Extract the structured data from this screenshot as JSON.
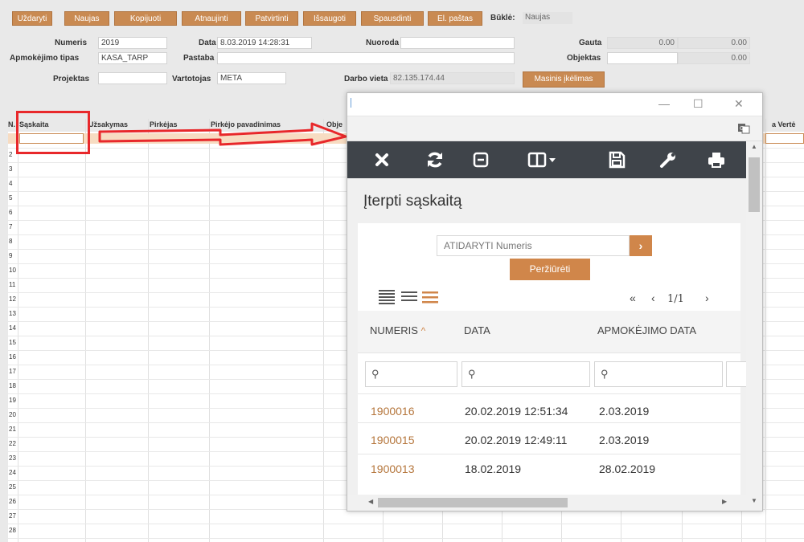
{
  "toolbar": {
    "buttons": [
      "Uždaryti",
      "Naujas",
      "Kopijuoti",
      "Atnaujinti",
      "Patvirtinti",
      "Išsaugoti",
      "Spausdinti",
      "El. paštas"
    ],
    "status_label": "Būklė:",
    "status_value": "Naujas"
  },
  "form": {
    "numeris_label": "Numeris",
    "numeris_value": "2019",
    "data_label": "Data",
    "data_value": "8.03.2019 14:28:31",
    "nuoroda_label": "Nuoroda",
    "nuoroda_value": "",
    "gauta_label": "Gauta",
    "gauta_value1": "0.00",
    "gauta_value2": "0.00",
    "apmokejimo_label": "Apmokėjimo tipas",
    "apmokejimo_value": "KASA_TARP",
    "pastaba_label": "Pastaba",
    "pastaba_value": "",
    "objektas_label": "Objektas",
    "objektas_value": "",
    "objektas_amount": "0.00",
    "projektas_label": "Projektas",
    "projektas_value": "",
    "vartotojas_label": "Vartotojas",
    "vartotojas_value": "META",
    "darbo_label": "Darbo vieta",
    "darbo_value": "82.135.174.44",
    "masinis_button": "Masinis įkėlimas"
  },
  "grid": {
    "headers": {
      "nr": "N.",
      "saskaita": "Sąskaita",
      "uzsakymas": "Užsakymas",
      "pirkejas": "Pirkėjas",
      "pavadinimas": "Pirkėjo pavadinimas",
      "obj": "Obje",
      "verte": "a Vertė"
    },
    "rows": [
      "1",
      "2",
      "3",
      "4",
      "5",
      "6",
      "7",
      "8",
      "9",
      "10",
      "11",
      "12",
      "13",
      "14",
      "15",
      "16",
      "17",
      "18",
      "19",
      "20",
      "21",
      "22",
      "23",
      "24",
      "25",
      "26",
      "27",
      "28"
    ]
  },
  "dialog": {
    "title": "Įterpti sąskaitą",
    "search_placeholder": "ATIDARYTI Numeris",
    "view_button": "Peržiūrėti",
    "pagination": "1/1",
    "columns": [
      "NUMERIS",
      "DATA",
      "APMOKĖJIMO DATA"
    ],
    "rows": [
      {
        "numeris": "1900016",
        "data": "20.02.2019 12:51:34",
        "apmokejimo_data": "2.03.2019"
      },
      {
        "numeris": "1900015",
        "data": "20.02.2019 12:49:11",
        "apmokejimo_data": "2.03.2019"
      },
      {
        "numeris": "1900013",
        "data": "18.02.2019",
        "apmokejimo_data": "28.02.2019"
      }
    ]
  },
  "colors": {
    "accent": "#c98a52",
    "link": "#b5763c",
    "dark_toolbar": "#3f444a",
    "arrow": "#e8282b"
  }
}
